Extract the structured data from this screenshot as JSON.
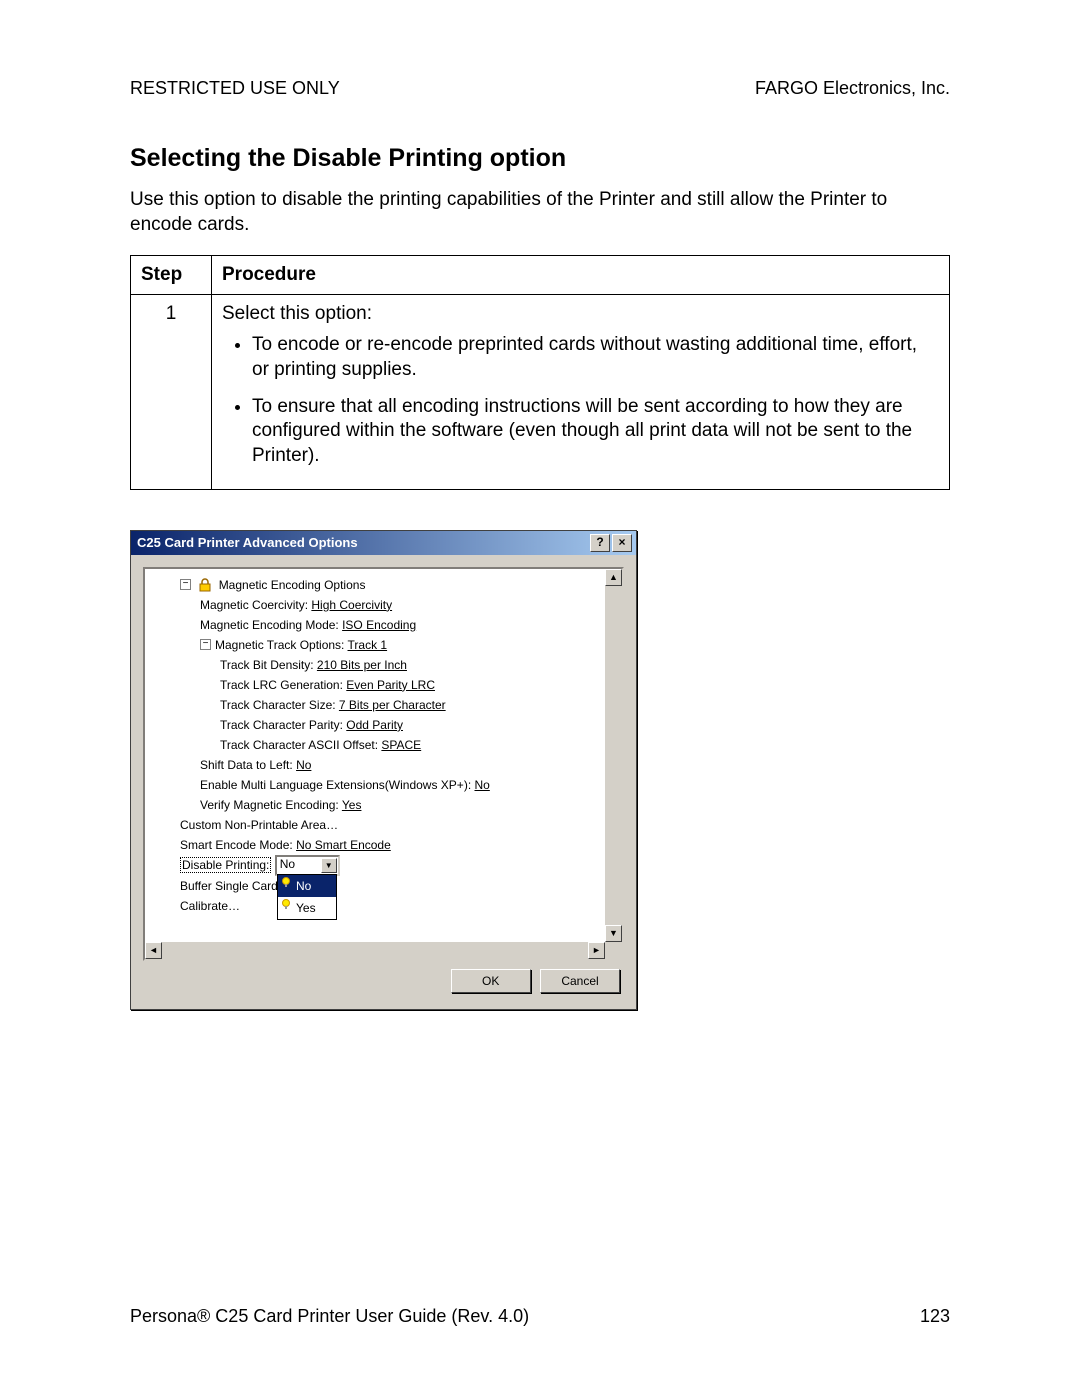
{
  "header": {
    "left": "RESTRICTED USE ONLY",
    "right": "FARGO Electronics, Inc."
  },
  "title": "Selecting the Disable Printing option",
  "intro": "Use this option to disable the printing capabilities of the Printer and still allow the Printer to encode cards.",
  "table": {
    "col1": "Step",
    "col2": "Procedure",
    "step": "1",
    "lead": "Select this option:",
    "b1": "To encode or re-encode preprinted cards without wasting additional time, effort, or printing supplies.",
    "b2": "To ensure that all encoding instructions will be sent according to how they are configured within the software (even though all print data will not be sent to the Printer)."
  },
  "dialog": {
    "title": "C25 Card Printer Advanced Options",
    "tree": {
      "n0": "Magnetic Encoding Options",
      "n1_label": "Magnetic Coercivity: ",
      "n1_val": "High Coercivity",
      "n2_label": "Magnetic Encoding Mode: ",
      "n2_val": "ISO Encoding",
      "n3_label": "Magnetic Track Options: ",
      "n3_val": "Track 1",
      "n4_label": "Track Bit Density: ",
      "n4_val": "210 Bits per Inch",
      "n5_label": "Track LRC Generation: ",
      "n5_val": "Even Parity LRC",
      "n6_label": "Track Character Size: ",
      "n6_val": "7 Bits per Character",
      "n7_label": "Track Character Parity: ",
      "n7_val": "Odd Parity",
      "n8_label": "Track Character ASCII Offset: ",
      "n8_val": "SPACE",
      "n9_label": "Shift Data to Left: ",
      "n9_val": "No",
      "n10_label": "Enable Multi Language Extensions(Windows XP+): ",
      "n10_val": "No",
      "n11_label": "Verify Magnetic Encoding: ",
      "n11_val": "Yes",
      "n12": "Custom Non-Printable Area…",
      "n13_label": "Smart Encode Mode: ",
      "n13_val": "No Smart Encode",
      "n14_label": "Disable Printing:",
      "n14_combo": "No",
      "n15_label": "Buffer Single Card",
      "n16": "Calibrate…",
      "dd_opt1": "No",
      "dd_opt2": "Yes"
    },
    "ok": "OK",
    "cancel": "Cancel"
  },
  "footer": {
    "left": "Persona® C25 Card Printer User Guide (Rev. 4.0)",
    "page": "123"
  }
}
